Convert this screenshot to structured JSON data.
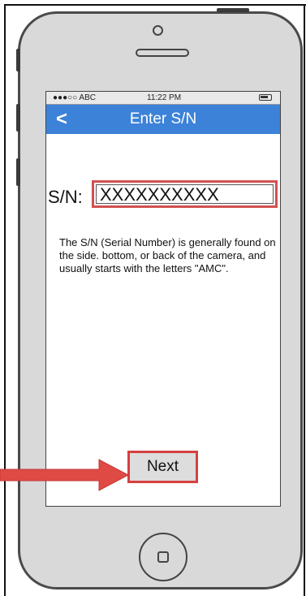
{
  "status_bar": {
    "carrier": "●●●○○ ABC",
    "time": "11:22 PM",
    "battery_icon": "battery-icon"
  },
  "nav": {
    "back_label": "<",
    "title": "Enter S/N"
  },
  "form": {
    "sn_label": "S/N:",
    "sn_value": "XXXXXXXXXX"
  },
  "help_text": "The S/N (Serial Number) is generally found on the side. bottom, or back of the camera, and usually starts with the letters \"AMC\".",
  "next_label": "Next",
  "colors": {
    "nav_bar": "#3c82d8",
    "highlight": "#d25050",
    "phone_body": "#d9d9d9"
  }
}
